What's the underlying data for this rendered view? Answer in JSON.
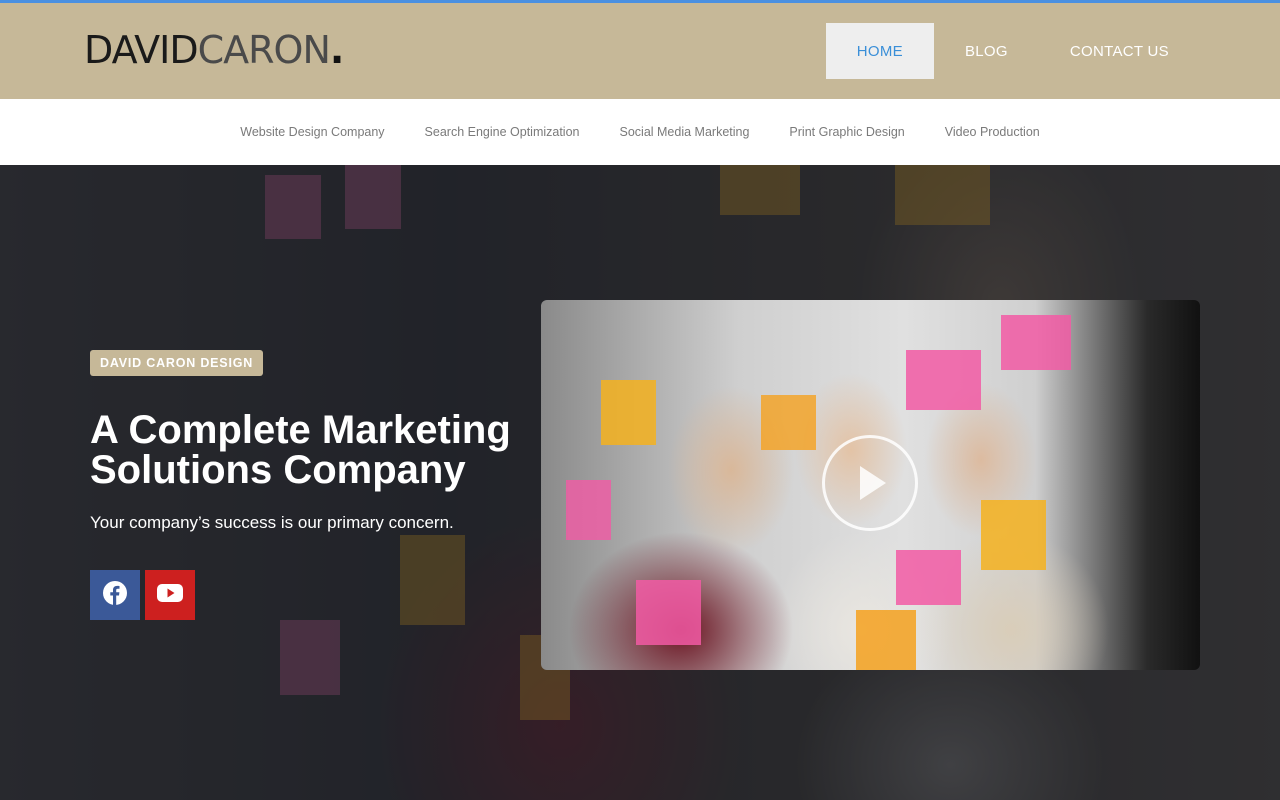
{
  "header": {
    "logo_part1": "DAVID",
    "logo_part2": "CARON",
    "logo_dot": ".",
    "nav": [
      {
        "label": "HOME"
      },
      {
        "label": "BLOG"
      },
      {
        "label": "CONTACT US"
      }
    ]
  },
  "subnav": {
    "items": [
      {
        "label": "Website Design Company"
      },
      {
        "label": "Search Engine Optimization"
      },
      {
        "label": "Social Media Marketing"
      },
      {
        "label": "Print Graphic Design"
      },
      {
        "label": "Video Production"
      }
    ]
  },
  "hero": {
    "badge": "DAVID CARON DESIGN",
    "headline": "A Complete Marketing Solutions Company",
    "tagline": "Your company’s success is our primary concern.",
    "social": [
      {
        "icon": "facebook-icon",
        "color": "#3b5998"
      },
      {
        "icon": "youtube-icon",
        "color": "#cd201f"
      }
    ]
  },
  "video": {
    "icon": "play-icon"
  },
  "colors": {
    "header_bg": "#c6b898",
    "accent_blue": "#3a8fd8",
    "badge_bg": "#c6b898"
  }
}
